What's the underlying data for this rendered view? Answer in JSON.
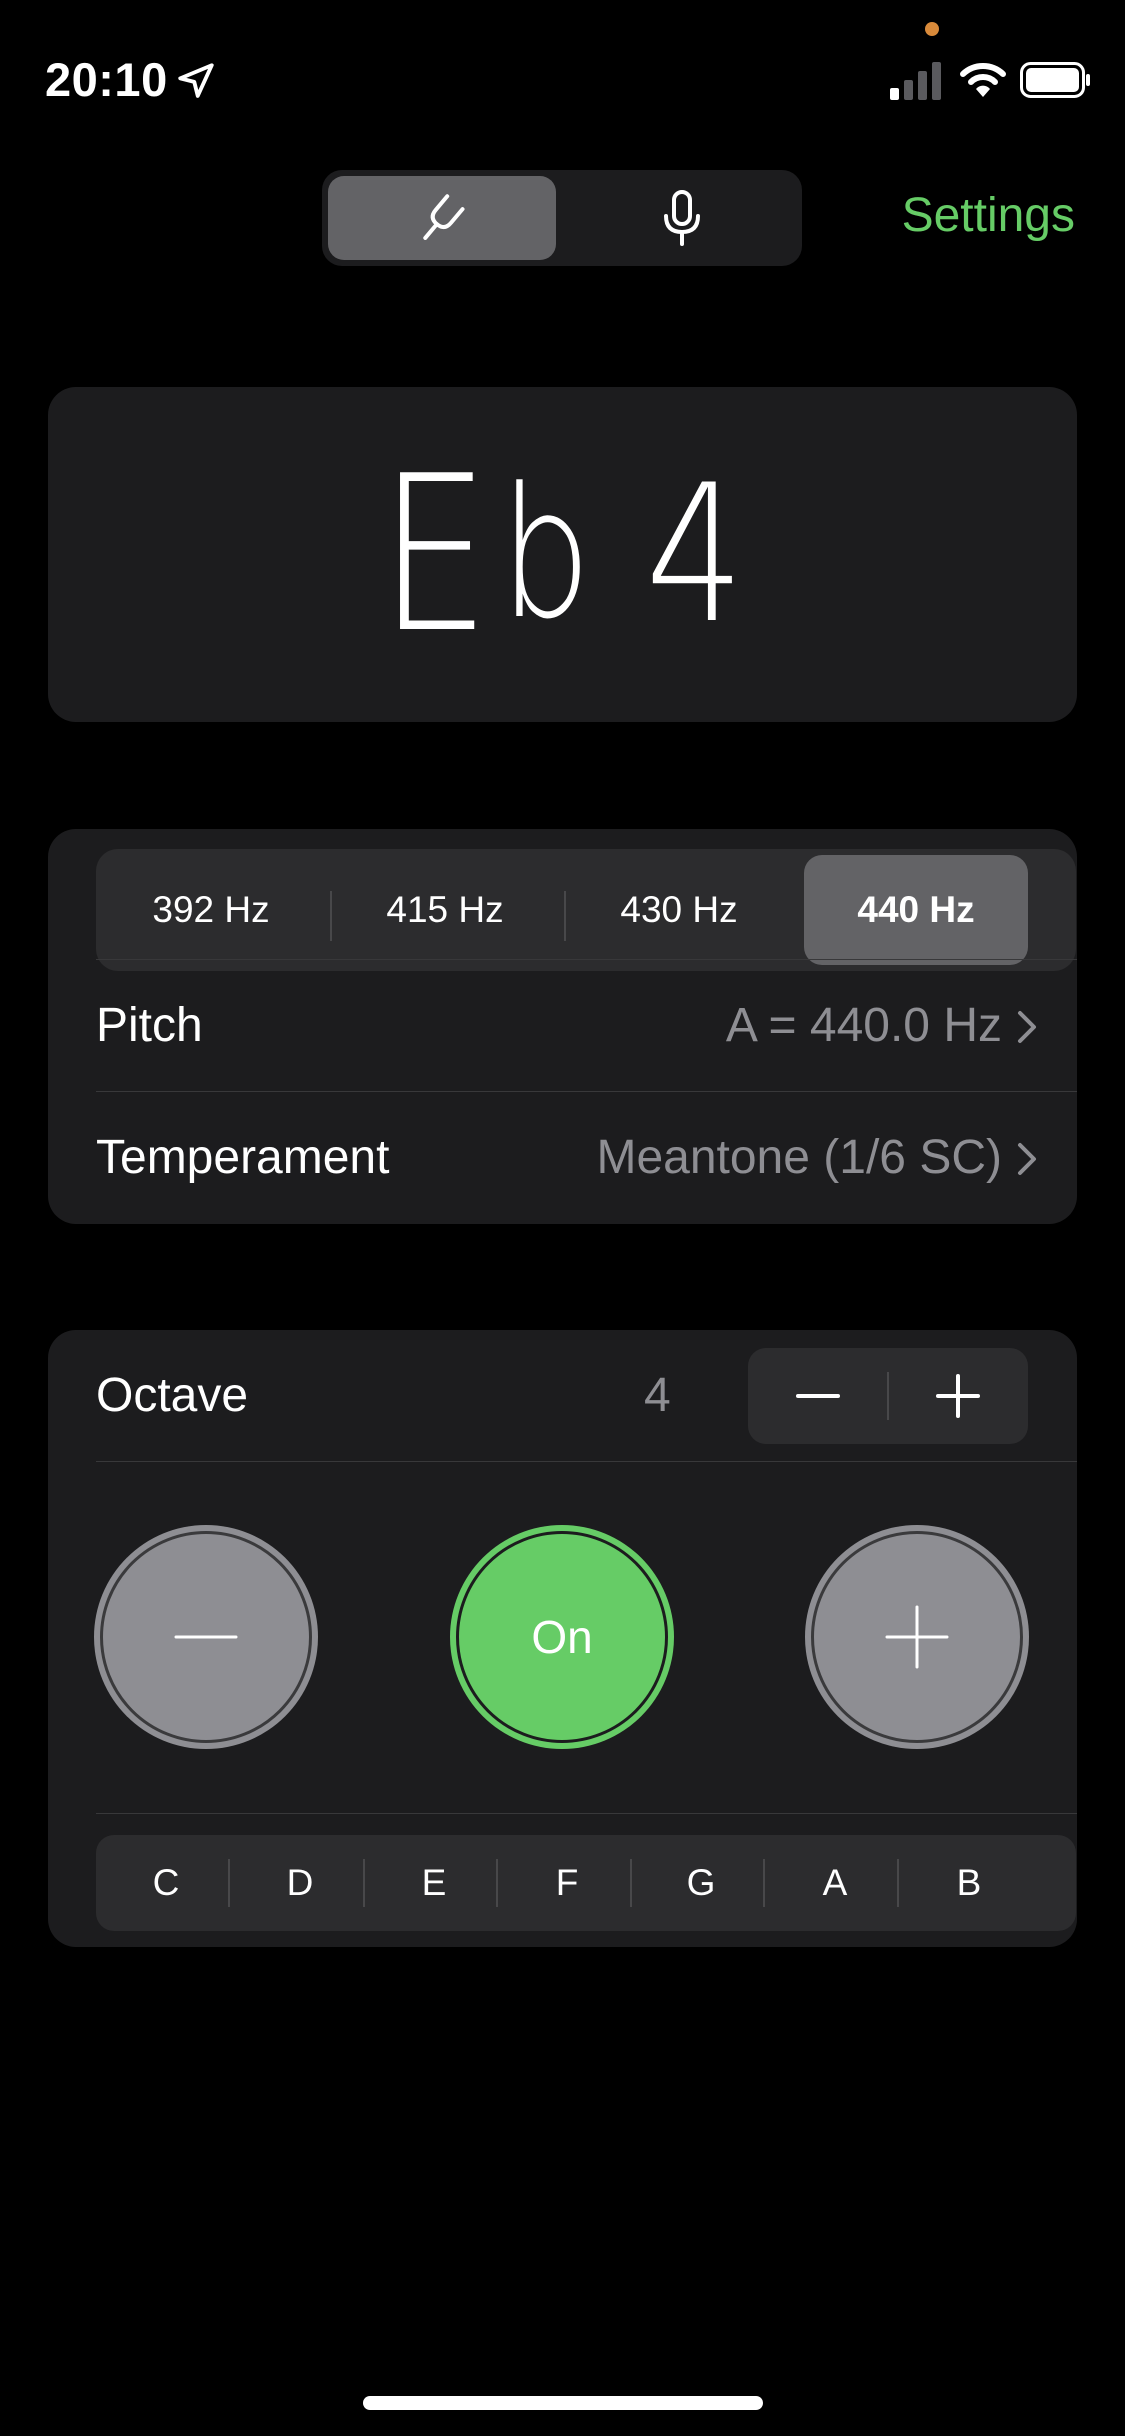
{
  "status_bar": {
    "time": "20:10",
    "location_icon": "location-arrow-icon",
    "signal_icon": "cellular-signal-icon",
    "wifi_icon": "wifi-icon",
    "battery_icon": "battery-icon",
    "privacy_dot_color": "#d98a3a"
  },
  "mode_switch": {
    "options": [
      {
        "icon": "tuning-fork-icon",
        "selected": true
      },
      {
        "icon": "microphone-icon",
        "selected": false
      }
    ]
  },
  "header": {
    "settings_label": "Settings"
  },
  "note_display": {
    "note": "E",
    "accidental": "b",
    "octave": "4"
  },
  "reference_pitch": {
    "options": [
      "392 Hz",
      "415 Hz",
      "430 Hz",
      "440 Hz"
    ],
    "selected": "440 Hz"
  },
  "rows": {
    "pitch": {
      "label": "Pitch",
      "value": "A = 440.0 Hz"
    },
    "temperament": {
      "label": "Temperament",
      "value": "Meantone (1/6 SC)"
    }
  },
  "octave": {
    "label": "Octave",
    "value": "4"
  },
  "controls": {
    "minus_icon": "minus-icon",
    "on_label": "On",
    "plus_icon": "plus-icon"
  },
  "notes": {
    "options": [
      "C",
      "D",
      "E",
      "F",
      "G",
      "A",
      "B"
    ]
  },
  "colors": {
    "background": "#000000",
    "card": "#1c1c1e",
    "accent_green": "#66cc66",
    "secondary_text": "#8e8e93",
    "segment_bg": "#2c2c2e",
    "segment_selected": "#636366"
  }
}
